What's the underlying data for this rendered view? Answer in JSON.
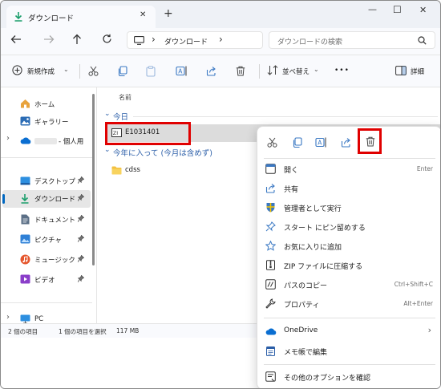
{
  "tab": {
    "title": "ダウンロード",
    "new_tab": "+"
  },
  "window_controls": {
    "minimize": "—",
    "maximize": "☐",
    "close": "✕"
  },
  "address": {
    "chevron1": "›",
    "folder": "ダウンロード",
    "chevron2": "›"
  },
  "search": {
    "placeholder": "ダウンロードの検索"
  },
  "toolbar": {
    "new": "新規作成",
    "sort": "並べ替え",
    "more": "•••",
    "details": "詳細"
  },
  "sidebar": {
    "home": "ホーム",
    "gallery": "ギャラリー",
    "onedrive": "- 個人用",
    "desktop": "デスクトップ",
    "downloads": "ダウンロード",
    "documents": "ドキュメント",
    "pictures": "ピクチャ",
    "music": "ミュージック",
    "videos": "ビデオ",
    "pc": "PC"
  },
  "content": {
    "column_name": "名前",
    "group_today": "今日",
    "file1": "E1031401",
    "group_this_year": "今年に入って (今月は含めず)",
    "folder1": "cdss"
  },
  "status": {
    "items": "2 個の項目",
    "selection": "1 個の項目を選択",
    "size": "117 MB"
  },
  "context_menu": {
    "items": [
      {
        "label": "開く",
        "shortcut": "Enter",
        "icon": "open-icon"
      },
      {
        "label": "共有",
        "shortcut": "",
        "icon": "share-icon"
      },
      {
        "label": "管理者として実行",
        "shortcut": "",
        "icon": "shield-icon"
      },
      {
        "label": "スタート にピン留めする",
        "shortcut": "",
        "icon": "pin-icon"
      },
      {
        "label": "お気に入りに追加",
        "shortcut": "",
        "icon": "star-icon"
      },
      {
        "label": "ZIP ファイルに圧縮する",
        "shortcut": "",
        "icon": "zip-icon"
      },
      {
        "label": "パスのコピー",
        "shortcut": "Ctrl+Shift+C",
        "icon": "path-icon"
      },
      {
        "label": "プロパティ",
        "shortcut": "Alt+Enter",
        "icon": "wrench-icon"
      },
      {
        "label": "OneDrive",
        "shortcut": "",
        "icon": "onedrive-icon"
      },
      {
        "label": "メモ帳で編集",
        "shortcut": "",
        "icon": "notepad-icon"
      },
      {
        "label": "その他のオプションを確認",
        "shortcut": "",
        "icon": "more-options-icon"
      }
    ],
    "submenu_chevron": "›"
  },
  "colors": {
    "accent": "#0067c0",
    "highlight": "#e00000",
    "selection": "#dcdcdc"
  }
}
